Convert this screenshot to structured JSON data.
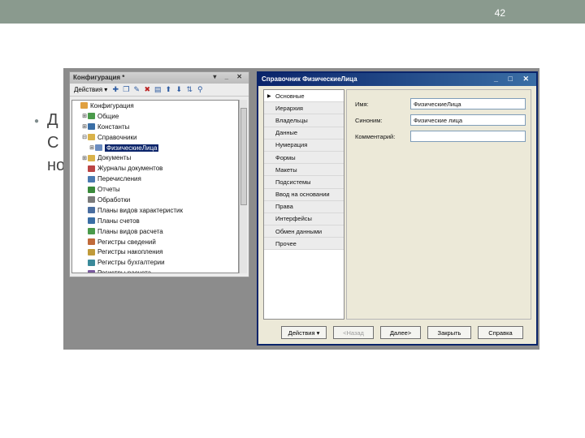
{
  "slide": {
    "number": "42"
  },
  "bullet": {
    "line1": "Д",
    "line2": "С",
    "line3": "но"
  },
  "tree_window": {
    "title": "Конфигурация *",
    "actions_label": "Действия ▾",
    "items": [
      {
        "label": "Конфигурация",
        "color": "#e0a040",
        "indent": 0,
        "ex": ""
      },
      {
        "label": "Общие",
        "color": "#4a9a4a",
        "indent": 1,
        "ex": "⊞"
      },
      {
        "label": "Константы",
        "color": "#3a6ea5",
        "indent": 1,
        "ex": "⊞"
      },
      {
        "label": "Справочники",
        "color": "#d9b24a",
        "indent": 1,
        "ex": "⊟"
      },
      {
        "label": "ФизическиеЛица",
        "color": "#6a8cc0",
        "indent": 2,
        "ex": "⊞",
        "selected": true
      },
      {
        "label": "Документы",
        "color": "#d9b24a",
        "indent": 1,
        "ex": "⊞"
      },
      {
        "label": "Журналы документов",
        "color": "#b44",
        "indent": 1,
        "ex": ""
      },
      {
        "label": "Перечисления",
        "color": "#4a7ab0",
        "indent": 1,
        "ex": ""
      },
      {
        "label": "Отчеты",
        "color": "#3a8a3a",
        "indent": 1,
        "ex": ""
      },
      {
        "label": "Обработки",
        "color": "#7a7a7a",
        "indent": 1,
        "ex": ""
      },
      {
        "label": "Планы видов характеристик",
        "color": "#4a6ea0",
        "indent": 1,
        "ex": ""
      },
      {
        "label": "Планы счетов",
        "color": "#3a6ea5",
        "indent": 1,
        "ex": ""
      },
      {
        "label": "Планы видов расчета",
        "color": "#4a9a4a",
        "indent": 1,
        "ex": ""
      },
      {
        "label": "Регистры сведений",
        "color": "#c06a3a",
        "indent": 1,
        "ex": ""
      },
      {
        "label": "Регистры накопления",
        "color": "#c09a3a",
        "indent": 1,
        "ex": ""
      },
      {
        "label": "Регистры бухгалтерии",
        "color": "#3a8a9a",
        "indent": 1,
        "ex": ""
      },
      {
        "label": "Регистры расчета",
        "color": "#7a5aa0",
        "indent": 1,
        "ex": ""
      }
    ]
  },
  "dialog": {
    "title": "Справочник ФизическиеЛица",
    "nav": [
      "Основные",
      "Иерархия",
      "Владельцы",
      "Данные",
      "Нумерация",
      "Формы",
      "Макеты",
      "Подсистемы",
      "Ввод на основании",
      "Права",
      "Интерфейсы",
      "Обмен данными",
      "Прочее"
    ],
    "fields": {
      "name_label": "Имя:",
      "name_value": "ФизическиеЛица",
      "synonym_label": "Синоним:",
      "synonym_value": "Физические лица",
      "comment_label": "Комментарий:",
      "comment_value": ""
    },
    "buttons": {
      "actions": "Действия ▾",
      "back": "<Назад",
      "next": "Далее>",
      "close": "Закрыть",
      "help": "Справка"
    }
  }
}
